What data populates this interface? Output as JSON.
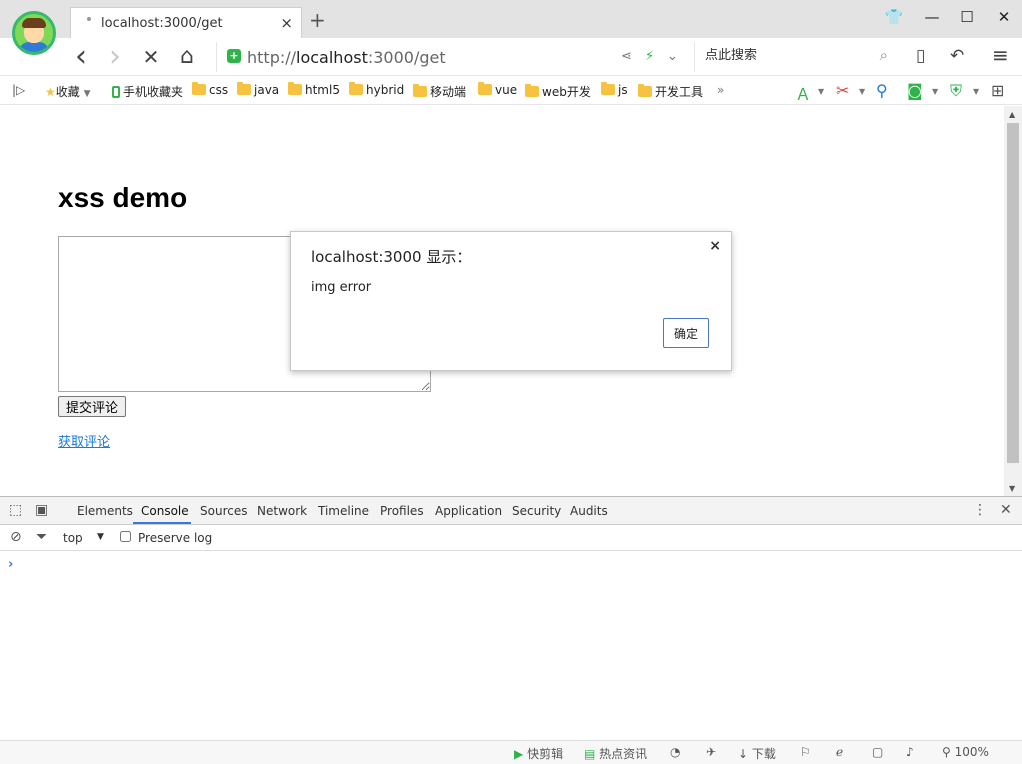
{
  "browser": {
    "tab": {
      "title": "localhost:3000/get",
      "close": "×"
    },
    "new_tab": "+",
    "window": {
      "skin": "👕",
      "minimize": "—",
      "maximize": "☐",
      "close": "✕"
    },
    "nav": {
      "back": "‹",
      "forward": "›",
      "stop": "✕",
      "home": "⌂"
    },
    "address": {
      "scheme": "http://",
      "host": "localhost",
      "rest": ":3000/get"
    },
    "address_tools": {
      "share": "⋖",
      "bolt": "⚡",
      "dropdown": "⌄"
    },
    "search": {
      "placeholder": "点此搜索",
      "icon": "⌕"
    },
    "toolbar": {
      "reader": "▯",
      "undo": "↶",
      "menu": "≡"
    }
  },
  "bookmarks": {
    "toggle": "|▷",
    "favorites": "收藏",
    "items": [
      "手机收藏夹",
      "css",
      "java",
      "html5",
      "hybrid",
      "移动端",
      "vue",
      "web开发",
      "js",
      "开发工具"
    ],
    "more": "»"
  },
  "page": {
    "heading": "xss demo",
    "textarea_value": "",
    "submit_label": "提交评论",
    "get_link": "获取评论"
  },
  "dialog": {
    "title": "localhost:3000 显示：",
    "message": "img error",
    "ok_label": "确定",
    "close": "×"
  },
  "devtools": {
    "tabs": [
      "Elements",
      "Console",
      "Sources",
      "Network",
      "Timeline",
      "Profiles",
      "Application",
      "Security",
      "Audits"
    ],
    "active_tab": "Console",
    "context": "top",
    "preserve_log": "Preserve log",
    "prompt": "›",
    "more": "⋮",
    "close": "✕"
  },
  "statusbar": {
    "items": [
      "快剪辑",
      "热点资讯",
      "下载"
    ],
    "zoom": "100%"
  },
  "colors": {
    "accent": "#3879d9",
    "secure": "#2fb34a",
    "folder": "#f5c242",
    "link": "#1a7bd8"
  }
}
